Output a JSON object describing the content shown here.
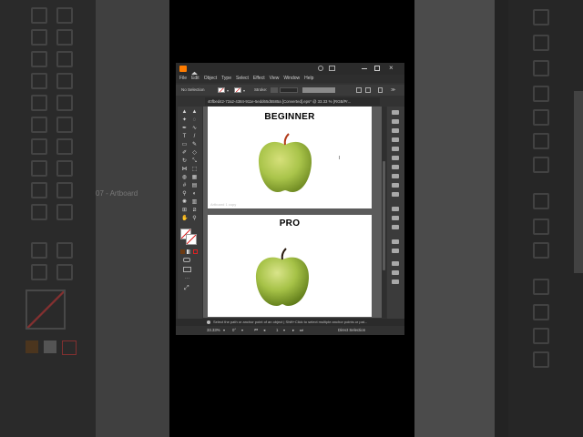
{
  "menu": [
    "File",
    "Edit",
    "Object",
    "Type",
    "Select",
    "Effect",
    "View",
    "Window",
    "Help"
  ],
  "control_bar": {
    "selection": "No Selection",
    "stroke_label": "Stroke:"
  },
  "document_tab": "40fbed42-72a2-4384-911e-5edd65d5585a [Converted].eps* @ 33.33 % (RGB/Pr...",
  "artboards": [
    {
      "heading": "BEGINNER",
      "label": "Artboard 1 copy"
    },
    {
      "heading": "PRO",
      "label": ""
    }
  ],
  "background_label": "07 - Artboard",
  "status_hint": "Select the path or anchor point of an object | Shift+Click to select multiple anchor points or pat...",
  "bottom_bar": {
    "zoom": "33.33%",
    "rotation": "0°",
    "artboard_number": "1",
    "mode": "Direct Selection"
  },
  "colors": {
    "apple_green": "#a9c44a",
    "canvas_gray": "#5b5b5b",
    "ui_dark": "#323232"
  },
  "icons": [
    "home-icon",
    "search-icon",
    "minimize-icon",
    "maximize-icon",
    "close-icon",
    "selection-tool-icon",
    "direct-selection-tool-icon",
    "pen-tool-icon",
    "type-tool-icon",
    "rectangle-tool-icon",
    "paintbrush-tool-icon",
    "rotate-tool-icon",
    "hand-tool-icon",
    "zoom-tool-icon",
    "fill-swatch-icon",
    "stroke-swatch-icon"
  ]
}
